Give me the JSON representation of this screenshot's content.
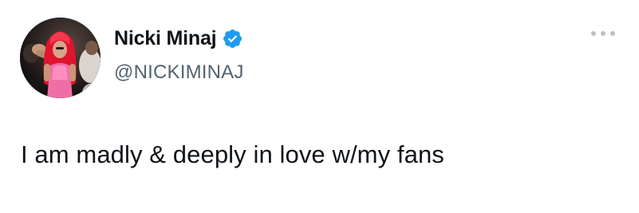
{
  "tweet": {
    "author": {
      "display_name": "Nicki Minaj",
      "handle": "@NICKIMINAJ",
      "verified": true,
      "avatar_icon": "profile-photo-avatar"
    },
    "text": "I am madly & deeply in love w/my fans",
    "more_icon": "more-options-icon",
    "colors": {
      "background": "#ffffff",
      "text": "#0f1419",
      "handle": "#536471",
      "verified_badge": "#1d9bf0"
    }
  }
}
